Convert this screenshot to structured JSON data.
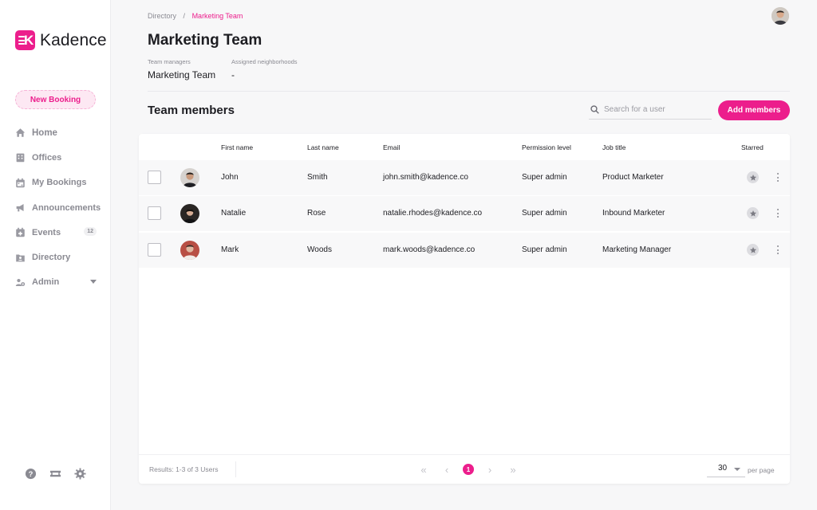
{
  "app": {
    "name": "Kadence"
  },
  "colors": {
    "accent": "#ec1e8c",
    "text": "#1d1d22",
    "muted": "#8a8a92"
  },
  "sidebar": {
    "new_booking_label": "New Booking",
    "items": [
      {
        "label": "Home",
        "icon": "home-icon"
      },
      {
        "label": "Offices",
        "icon": "building-icon"
      },
      {
        "label": "My Bookings",
        "icon": "calendar-icon"
      },
      {
        "label": "Announcements",
        "icon": "megaphone-icon"
      },
      {
        "label": "Events",
        "icon": "calendar-plus-icon",
        "badge": "12"
      },
      {
        "label": "Directory",
        "icon": "folder-user-icon"
      },
      {
        "label": "Admin",
        "icon": "users-cog-icon"
      }
    ],
    "bottom_icons": [
      "help-icon",
      "ticket-icon",
      "gear-icon"
    ]
  },
  "breadcrumb": {
    "root": "Directory",
    "separator": "/",
    "current": "Marketing Team"
  },
  "page": {
    "title": "Marketing Team",
    "team_managers_label": "Team managers",
    "team_managers_value": "Marketing Team",
    "neighborhoods_label": "Assigned neighborhoods",
    "neighborhoods_value": "-"
  },
  "members": {
    "title": "Team members",
    "search_placeholder": "Search for a user",
    "add_label": "Add members",
    "columns": {
      "first_name": "First name",
      "last_name": "Last name",
      "email": "Email",
      "permission": "Permission level",
      "job_title": "Job title",
      "starred": "Starred"
    },
    "rows": [
      {
        "first_name": "John",
        "last_name": "Smith",
        "email": "john.smith@kadence.co",
        "permission": "Super admin",
        "job_title": "Product Marketer"
      },
      {
        "first_name": "Natalie",
        "last_name": "Rose",
        "email": "natalie.rhodes@kadence.co",
        "permission": "Super admin",
        "job_title": "Inbound Marketer"
      },
      {
        "first_name": "Mark",
        "last_name": "Woods",
        "email": "mark.woods@kadence.co",
        "permission": "Super admin",
        "job_title": "Marketing Manager"
      }
    ]
  },
  "pagination": {
    "results_text": "Results: 1-3 of 3 Users",
    "current_page": "1",
    "per_page_value": "30",
    "per_page_label": "per page"
  }
}
